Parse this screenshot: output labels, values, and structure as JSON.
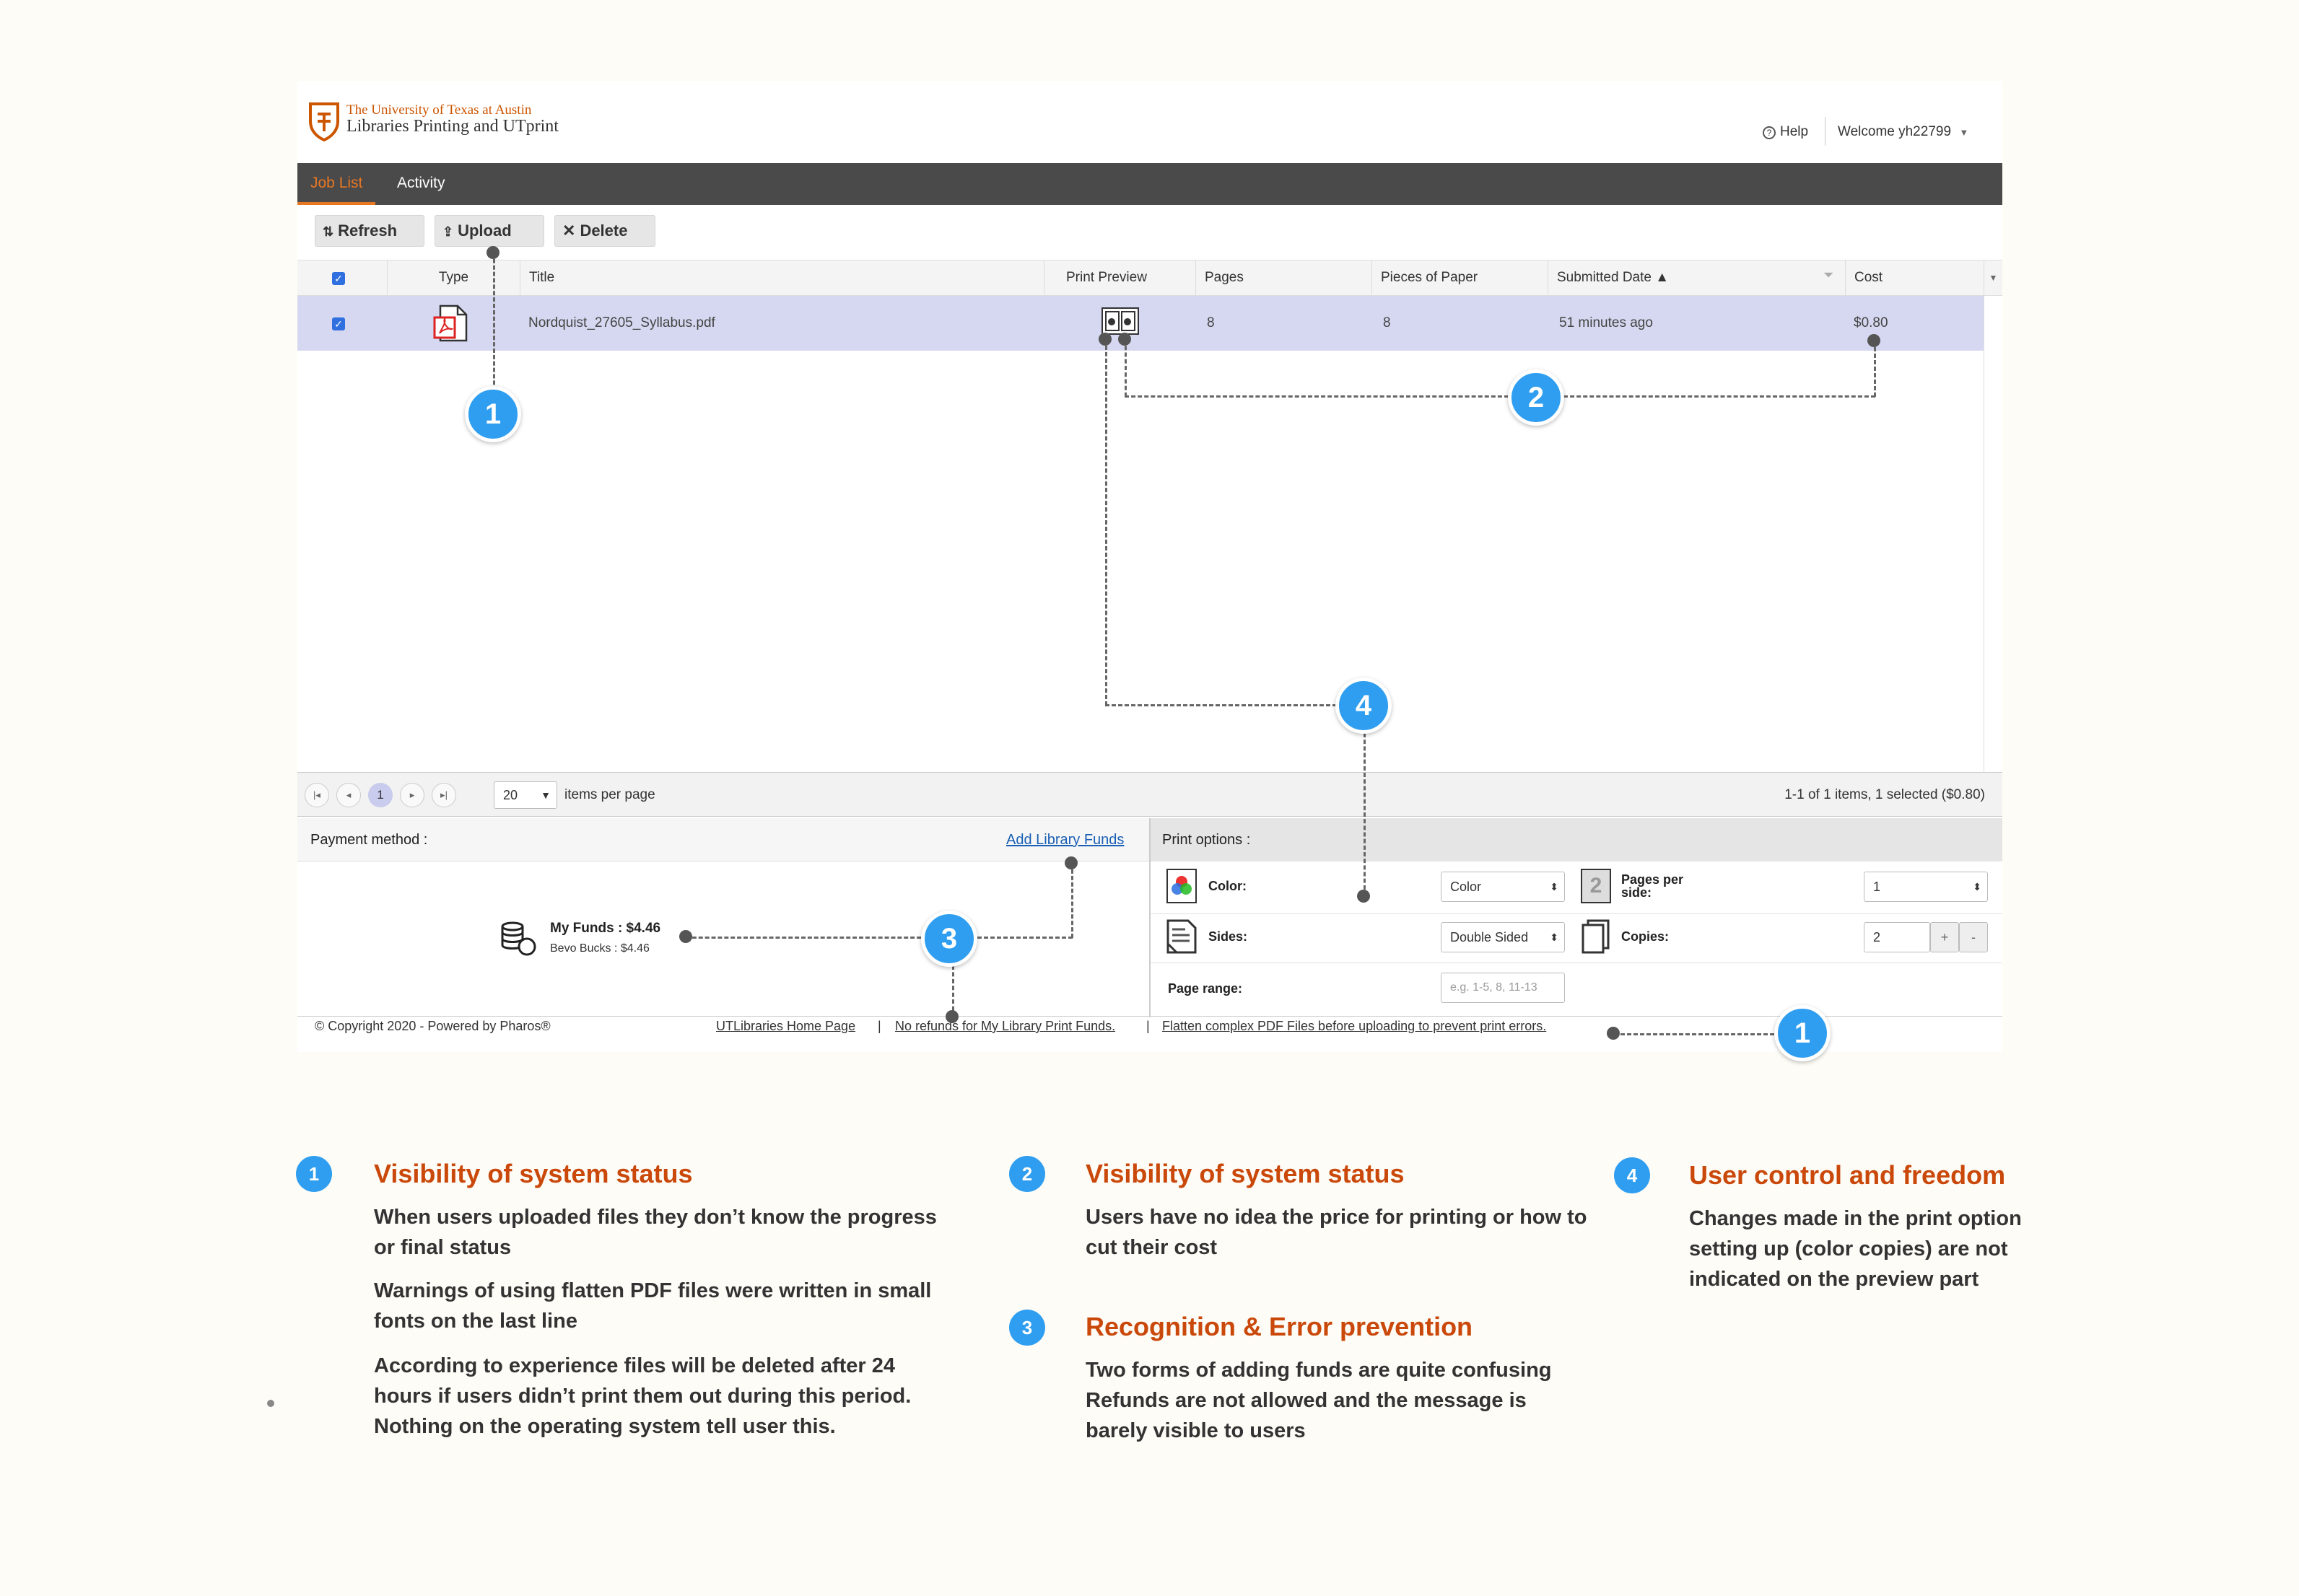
{
  "header": {
    "logo_line1": "The University of Texas at Austin",
    "logo_line2": "Libraries Printing and UTprint",
    "help": "Help",
    "welcome": "Welcome yh22799"
  },
  "tabs": [
    {
      "label": "Job List",
      "active": true
    },
    {
      "label": "Activity",
      "active": false
    }
  ],
  "toolbar": {
    "refresh": "Refresh",
    "upload": "Upload",
    "delete": "Delete"
  },
  "table": {
    "columns": [
      "Type",
      "Title",
      "Print Preview",
      "Pages",
      "Pieces of Paper",
      "Submitted Date ▲",
      "Cost"
    ],
    "rows": [
      {
        "title": "Nordquist_27605_Syllabus.pdf",
        "pages": "8",
        "pieces": "8",
        "submitted": "51 minutes ago",
        "cost": "$0.80"
      }
    ]
  },
  "pager": {
    "page": "1",
    "per_page": "20",
    "per_page_label": "items per page",
    "summary": "1-1 of 1 items, 1 selected ($0.80)"
  },
  "payment": {
    "label": "Payment method :",
    "add_funds": "Add Library Funds",
    "my_funds": "My Funds : $4.46",
    "bevo": "Bevo Bucks : $4.46"
  },
  "print_options": {
    "label": "Print options :",
    "color_label": "Color:",
    "color_value": "Color",
    "pps_label": "Pages per side:",
    "pps_value": "1",
    "sides_label": "Sides:",
    "sides_value": "Double Sided",
    "copies_label": "Copies:",
    "copies_value": "2",
    "range_label": "Page range:",
    "range_placeholder": "e.g. 1-5, 8, 11-13"
  },
  "footer": {
    "copyright": "© Copyright 2020 - Powered by Pharos®",
    "link1": "UTLibraries Home Page",
    "link2": "No refunds for My Library Print Funds.",
    "link3": "Flatten complex PDF Files before uploading to prevent print errors.",
    "sep": "|"
  },
  "markers": [
    "1",
    "2",
    "3",
    "4",
    "1"
  ],
  "annotations": {
    "a1": {
      "num": "1",
      "title": "Visibility of system status",
      "p1": "When users uploaded files they don’t know the progress or final status",
      "p2": "Warnings of using flatten PDF files were written in small fonts on the last line",
      "p3": "According to experience files will be deleted after 24 hours if users didn’t print them out during this period. Nothing on the operating system tell user this."
    },
    "a2": {
      "num": "2",
      "title": "Visibility of system status",
      "p1": "Users have no idea the price for printing or how to cut their cost"
    },
    "a3": {
      "num": "3",
      "title": "Recognition & Error prevention",
      "p1": "Two forms of adding funds are quite confusing Refunds are not allowed and the message is barely visible to users"
    },
    "a4": {
      "num": "4",
      "title": "User control and freedom",
      "p1": "Changes made in the print option setting up (color copies) are not indicated on the preview part"
    }
  },
  "colors": {
    "accent": "#c9480a",
    "marker": "#2f9ef0",
    "navbar": "#4a4a4a",
    "row_selected": "#d5d8f0"
  }
}
